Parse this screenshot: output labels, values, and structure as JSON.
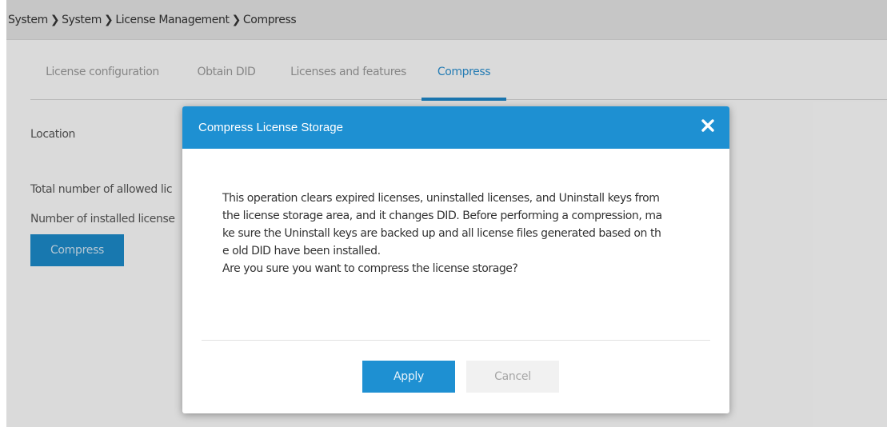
{
  "breadcrumb": [
    "System",
    "System",
    "License Management",
    "Compress"
  ],
  "tabs": [
    {
      "label": "License configuration"
    },
    {
      "label": "Obtain DID"
    },
    {
      "label": "Licenses and features"
    },
    {
      "label": "Compress"
    }
  ],
  "page": {
    "location_label": "Location",
    "total_allowed_label": "Total number of allowed lic",
    "installed_label": "Number of installed license",
    "compress_button": "Compress"
  },
  "dialog": {
    "title": "Compress License Storage",
    "close_icon": "close-icon",
    "message_lines": [
      "This operation clears expired licenses, uninstalled licenses, and Uninstall keys from",
      "the license storage area, and it changes DID. Before performing a compression, ma",
      "ke sure the Uninstall keys are backed up and all license files generated based on th",
      "e old DID have been installed.",
      "Are you sure you want to compress the license storage?"
    ],
    "apply_label": "Apply",
    "cancel_label": "Cancel"
  },
  "colors": {
    "accent": "#1e90d2",
    "breadcrumb_bg": "#e4e4e4",
    "tab_inactive": "#9a9a9a",
    "tab_active": "#2b8fcf"
  }
}
